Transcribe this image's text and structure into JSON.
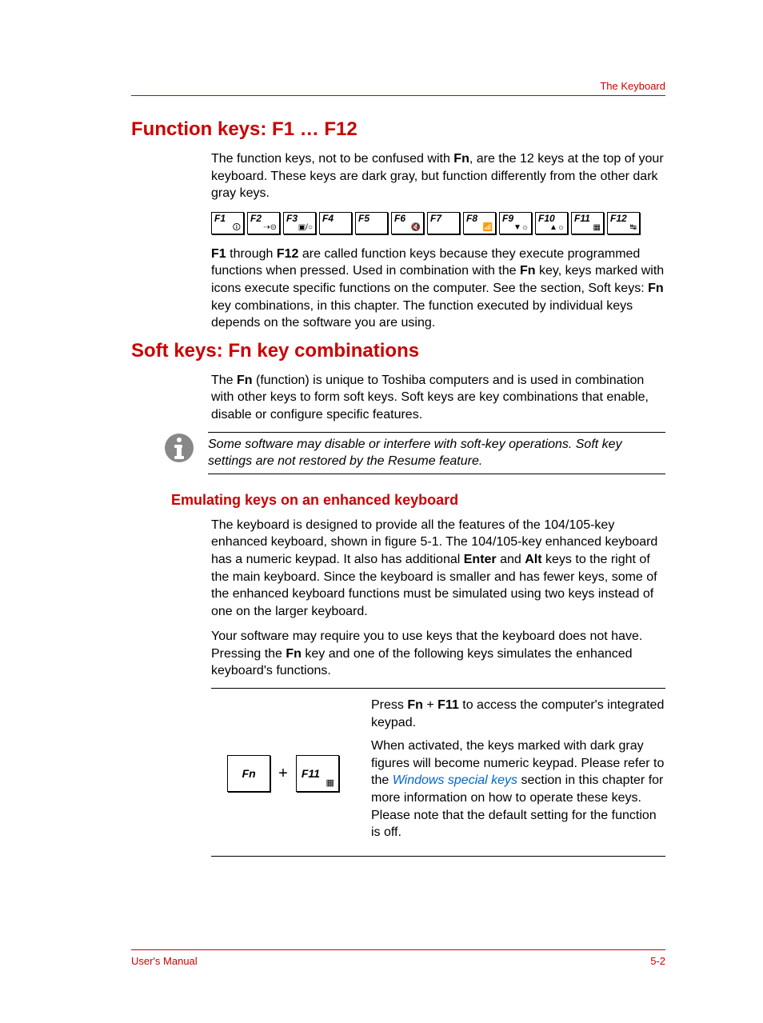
{
  "header": {
    "label": "The Keyboard"
  },
  "sections": {
    "fkeys": {
      "title": "Function keys: F1 … F12",
      "intro_pre": "The function keys, not to be confused with ",
      "intro_bold1": "Fn",
      "intro_post": ", are the 12 keys at the top of your keyboard. These keys are dark gray, but function differently from the other dark gray keys.",
      "keys": [
        "F1",
        "F2",
        "F3",
        "F4",
        "F5",
        "F6",
        "F7",
        "F8",
        "F9",
        "F10",
        "F11",
        "F12"
      ],
      "para2_a": "F1",
      "para2_b": " through ",
      "para2_c": "F12",
      "para2_d": " are called function keys because they execute programmed functions when pressed. Used in combination with the ",
      "para2_e": "Fn",
      "para2_f": " key, keys marked with icons execute specific functions on the computer. See the section, Soft keys: ",
      "para2_g": "Fn",
      "para2_h": " key combinations, in this chapter. The function executed by individual keys depends on the software you are using."
    },
    "softkeys": {
      "title": "Soft keys: Fn key combinations",
      "p1_a": "The ",
      "p1_b": "Fn",
      "p1_c": " (function) is unique to Toshiba computers and is used in combination with other keys to form soft keys. Soft keys are key combinations that enable, disable or configure specific features.",
      "note": "Some software may disable or interfere with soft-key operations. Soft key settings are not restored by the Resume feature.",
      "sub_title": "Emulating keys on an enhanced keyboard",
      "sp1_a": "The keyboard is designed to provide all the features of the 104/105-key enhanced keyboard, shown in figure 5-1. The 104/105-key enhanced keyboard has a numeric keypad. It also has additional ",
      "sp1_b": "Enter",
      "sp1_c": " and ",
      "sp1_d": "Alt",
      "sp1_e": " keys to the right of the main keyboard. Since the keyboard is smaller and has fewer keys, some of the enhanced keyboard functions must be simulated using two keys instead of one on the larger keyboard.",
      "sp2_a": "Your software may require you to use keys that the keyboard does not have. Pressing the ",
      "sp2_b": "Fn",
      "sp2_c": " key and one of the following keys simulates the enhanced keyboard's functions.",
      "combo": {
        "key1": "Fn",
        "plus": "+",
        "key2": "F11",
        "d1_a": "Press ",
        "d1_b": "Fn",
        "d1_c": " + ",
        "d1_d": "F11",
        "d1_e": " to access the computer's integrated keypad.",
        "d2_a": "When activated, the keys marked with dark gray figures will become numeric keypad. Please refer to the ",
        "d2_link": "Windows special keys",
        "d2_b": " section in this chapter for more information on how to operate these keys. Please note that the default setting for the function is off."
      }
    }
  },
  "footer": {
    "left": "User's Manual",
    "right": "5-2"
  }
}
